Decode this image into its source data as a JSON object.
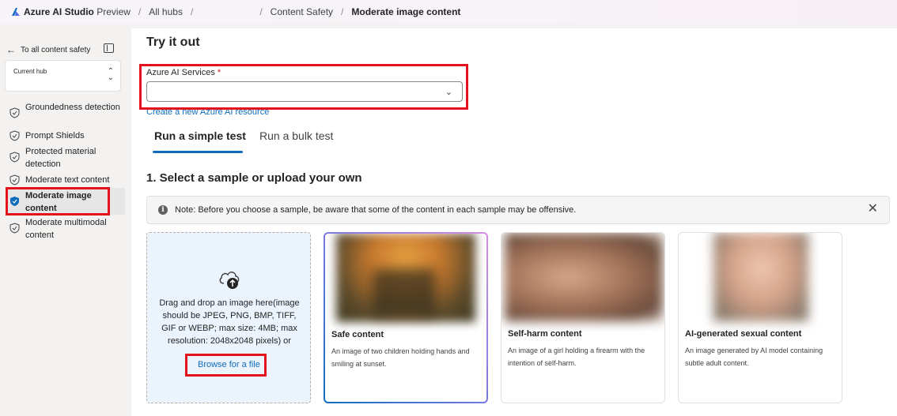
{
  "topbar": {
    "app_name": "Azure AI Studio",
    "app_suffix": "Preview",
    "breadcrumb": [
      "All hubs",
      "Content Safety",
      "Moderate image content"
    ]
  },
  "sidebar": {
    "back_label": "To all content safety",
    "hub_label": "Current hub",
    "items": [
      {
        "label": "Groundedness detection"
      },
      {
        "label": "Prompt Shields"
      },
      {
        "label": "Protected material detection"
      },
      {
        "label": "Moderate text content"
      },
      {
        "label": "Moderate image content",
        "active": true
      },
      {
        "label": "Moderate multimodal content"
      }
    ]
  },
  "main": {
    "title": "Try it out",
    "service_label": "Azure AI Services",
    "required_mark": "*",
    "create_link": "Create a new Azure AI resource",
    "tabs": [
      "Run a simple test",
      "Run a bulk test"
    ],
    "section_title": "1. Select a sample or upload your own",
    "note": "Note: Before you choose a sample, be aware that some of the content in each sample may be offensive.",
    "upload_text": "Drag and drop an image here(image should be JPEG, PNG, BMP, TIFF, GIF or WEBP; max size: 4MB; max resolution: 2048x2048 pixels) or",
    "browse_label": "Browse for a file",
    "samples": [
      {
        "title": "Safe content",
        "desc": "An image of two children holding hands and smiling at sunset."
      },
      {
        "title": "Self-harm content",
        "desc": "An image of a girl holding a firearm with the intention of self-harm."
      },
      {
        "title": "AI-generated sexual content",
        "desc": "An image generated by AI model containing subtle adult content."
      }
    ]
  },
  "colors": {
    "accent": "#0f6cbd",
    "highlight": "#e3121b"
  }
}
